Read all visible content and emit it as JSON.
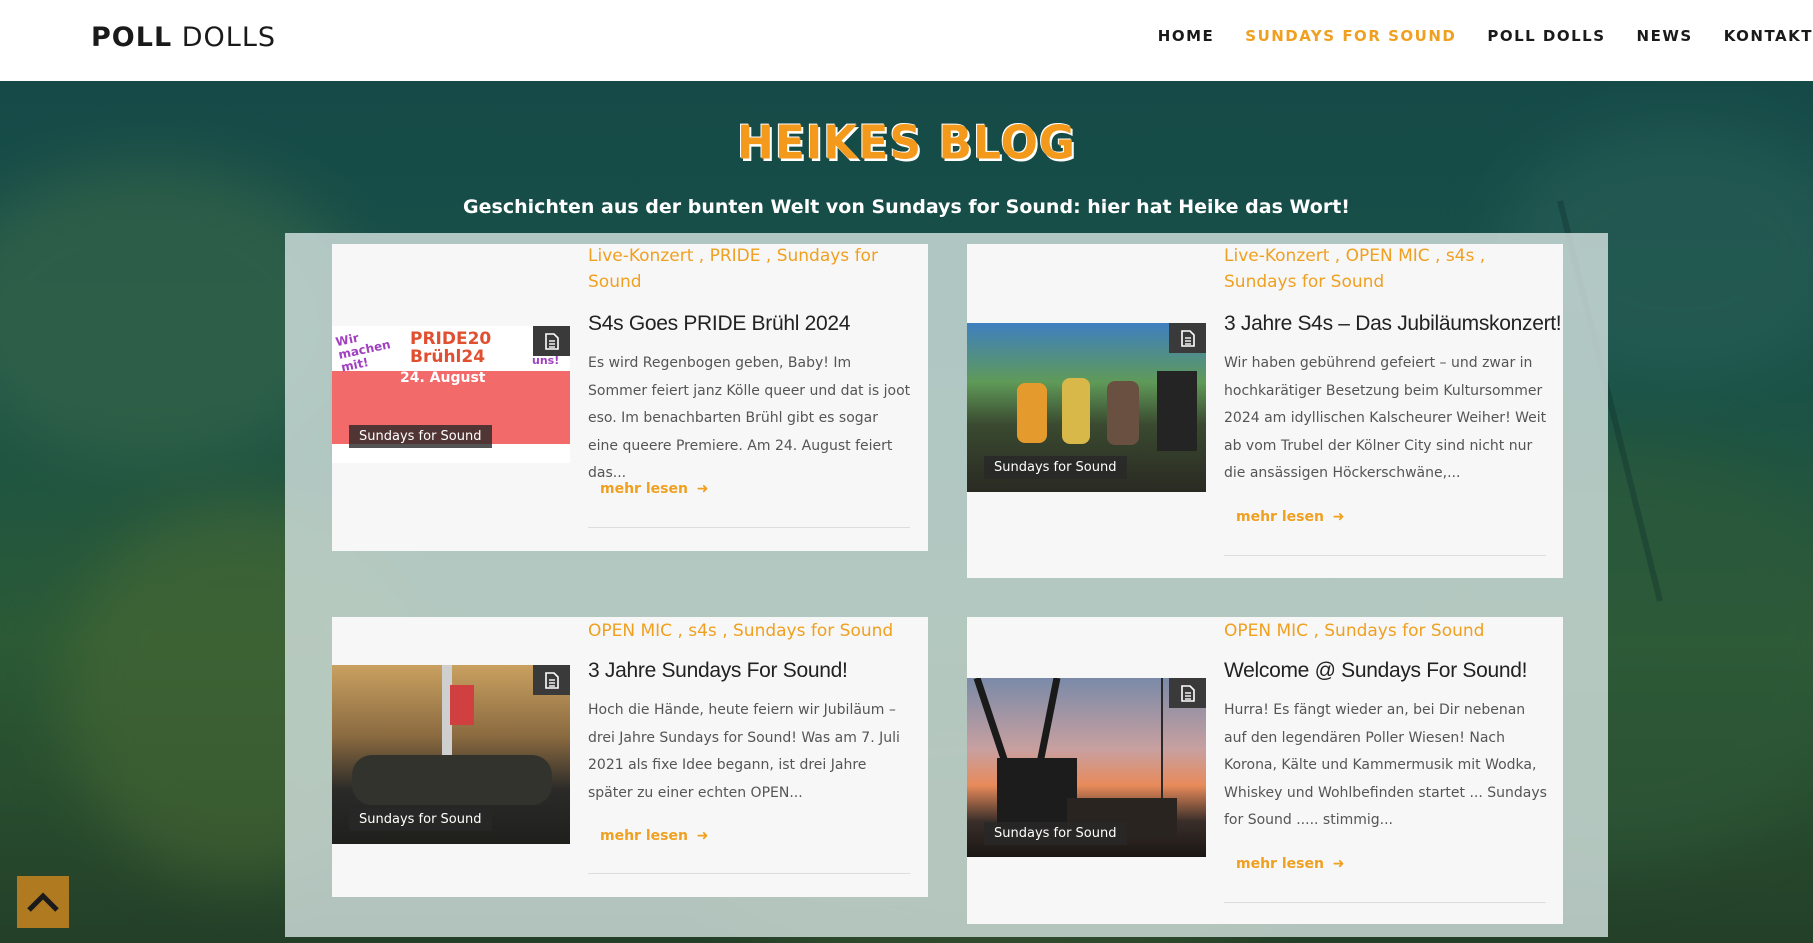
{
  "header": {
    "logo_bold": "POLL",
    "logo_light": "DOLLS",
    "nav": [
      {
        "label": "HOME",
        "active": false
      },
      {
        "label": "SUNDAYS FOR SOUND",
        "active": true
      },
      {
        "label": "POLL DOLLS",
        "active": false
      },
      {
        "label": "NEWS",
        "active": false
      },
      {
        "label": "KONTAKT",
        "active": false
      }
    ]
  },
  "hero": {
    "title": "HEIKES BLOG",
    "subtitle": "Geschichten aus der bunten Welt von Sundays for Sound: hier hat Heike das Wort!"
  },
  "posts": [
    {
      "categories": "Live-Konzert , PRIDE , Sundays for Sound",
      "title": "S4s Goes PRIDE Brühl 2024",
      "excerpt": "Es wird Regenbogen geben, Baby! Im Sommer feiert janz Kölle queer und dat is joot eso. Im benachbarten Brühl gibt es sogar eine queere Premiere. Am 24. August feiert das...",
      "more": "mehr lesen",
      "image_label": "Sundays for Sound",
      "poster": {
        "line1": "Wir machen mit!",
        "line2": "PRIDE20 Brühl24",
        "line3": "24. August",
        "corner": "uns!"
      }
    },
    {
      "categories": "Live-Konzert , OPEN MIC , s4s , Sundays for Sound",
      "title": "3 Jahre S4s – Das Jubiläumskonzert!",
      "excerpt": "Wir haben gebührend gefeiert – und zwar in hochkarätiger Besetzung beim Kultursommer 2024 am idyllischen Kalscheurer Weiher! Weit ab vom Trubel der Kölner City sind nicht nur die ansässigen Höckerschwäne,...",
      "more": "mehr lesen",
      "image_label": "Sundays for Sound"
    },
    {
      "categories": "OPEN MIC , s4s , Sundays for Sound",
      "title": "3 Jahre Sundays For Sound!",
      "excerpt": "Hoch die Hände, heute feiern wir Jubiläum – drei Jahre Sundays for Sound! Was am 7. Juli 2021 als fixe Idee begann, ist drei Jahre später zu einer echten OPEN...",
      "more": "mehr lesen",
      "image_label": "Sundays for Sound"
    },
    {
      "categories": "OPEN MIC , Sundays for Sound",
      "title": "Welcome @ Sundays For Sound!",
      "excerpt": "Hurra! Es fängt wieder an, bei Dir nebenan auf den legendären Poller Wiesen! Nach Korona, Kälte und Kammermusik mit Wodka, Whiskey und Wohlbefinden startet ... Sundays for Sound ..... stimmig...",
      "more": "mehr lesen",
      "image_label": "Sundays for Sound"
    }
  ],
  "colors": {
    "accent": "#f0a020",
    "header_bg": "#ffffff",
    "card_bg": "#f7f7f7"
  },
  "icons": {
    "back_to_top": "chevron-up-icon",
    "post_format": "document-icon",
    "read_more": "arrow-right-icon"
  }
}
